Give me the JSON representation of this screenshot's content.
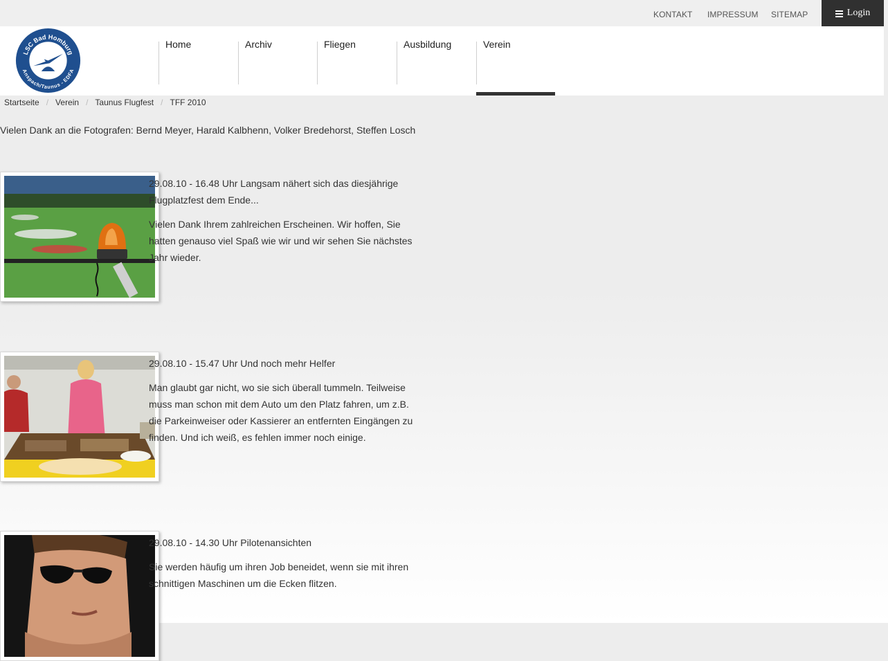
{
  "topbar": {
    "links": [
      "KONTAKT",
      "IMPRESSUM",
      "SITEMAP"
    ],
    "login_label": "Login",
    "login_icon": "hamburger-icon"
  },
  "logo": {
    "text_top": "LSC Bad Homburg",
    "text_bottom": "Anspach/Taunus - EDFA",
    "brand_color": "#1f4f8f"
  },
  "nav": {
    "items": [
      "Home",
      "Archiv",
      "Fliegen",
      "Ausbildung",
      "Verein"
    ],
    "active": "Verein"
  },
  "breadcrumb": [
    "Startseite",
    "Verein",
    "Taunus Flugfest",
    "TFF 2010"
  ],
  "intro": "Vielen Dank an die Fotografen: Bernd Meyer, Harald Kalbhenn, Volker Bredehorst, Steffen Losch",
  "articles": [
    {
      "title": "29.08.10 - 16.48 Uhr Langsam nähert sich das diesjährige Flugplatzfest dem Ende...",
      "body": "Vielen Dank Ihrem zahlreichen Erscheinen. Wir hoffen, Sie hatten genauso viel Spaß wie wir und wir sehen Sie nächstes Jahr wieder."
    },
    {
      "title": "29.08.10 - 15.47 Uhr Und noch mehr Helfer",
      "body": "Man glaubt gar nicht, wo sie sich überall tummeln. Teilweise muss man schon mit dem Auto um den Platz fahren, um z.B. die Parkeinweiser oder Kassierer an entfernten Eingängen zu finden. Und ich weiß, es fehlen immer noch einige."
    },
    {
      "title": "29.08.10 - 14.30 Uhr Pilotenansichten",
      "body": "Sie werden häufig um ihren Job beneidet, wenn sie mit ihren schnittigen Maschinen um die Ecken flitzen."
    }
  ]
}
